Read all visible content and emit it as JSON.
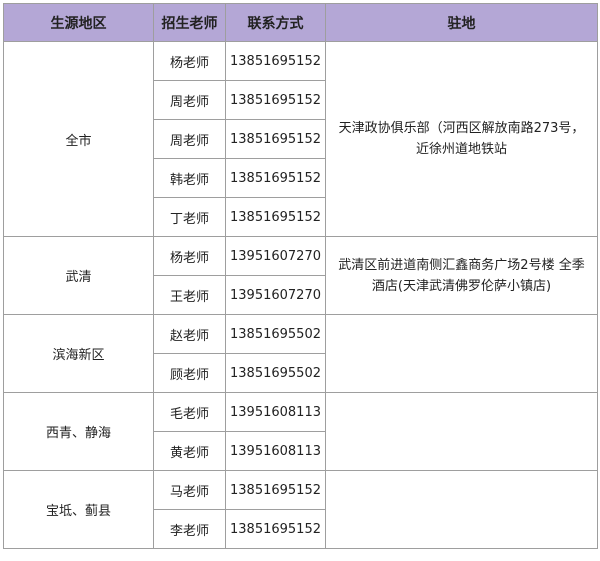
{
  "columns": [
    "生源地区",
    "招生老师",
    "联系方式",
    "驻地"
  ],
  "groups": [
    {
      "region": "全市",
      "address": "天津政协俱乐部（河西区解放南路273号，近徐州道地铁站",
      "contacts": [
        {
          "teacher": "杨老师",
          "phone": "13851695152"
        },
        {
          "teacher": "周老师",
          "phone": "13851695152"
        },
        {
          "teacher": "周老师",
          "phone": "13851695152"
        },
        {
          "teacher": "韩老师",
          "phone": "13851695152"
        },
        {
          "teacher": "丁老师",
          "phone": "13851695152"
        }
      ]
    },
    {
      "region": "武清",
      "address": "武清区前进道南侧汇鑫商务广场2号楼 全季酒店(天津武清佛罗伦萨小镇店)",
      "contacts": [
        {
          "teacher": "杨老师",
          "phone": "13951607270"
        },
        {
          "teacher": "王老师",
          "phone": "13951607270"
        }
      ]
    },
    {
      "region": "滨海新区",
      "address": "",
      "contacts": [
        {
          "teacher": "赵老师",
          "phone": "13851695502"
        },
        {
          "teacher": "顾老师",
          "phone": "13851695502"
        }
      ]
    },
    {
      "region": "西青、静海",
      "address": "",
      "contacts": [
        {
          "teacher": "毛老师",
          "phone": "13951608113"
        },
        {
          "teacher": "黄老师",
          "phone": "13951608113"
        }
      ]
    },
    {
      "region": "宝坻、蓟县",
      "address": "",
      "contacts": [
        {
          "teacher": "马老师",
          "phone": "13851695152"
        },
        {
          "teacher": "李老师",
          "phone": "13851695152"
        }
      ]
    }
  ]
}
